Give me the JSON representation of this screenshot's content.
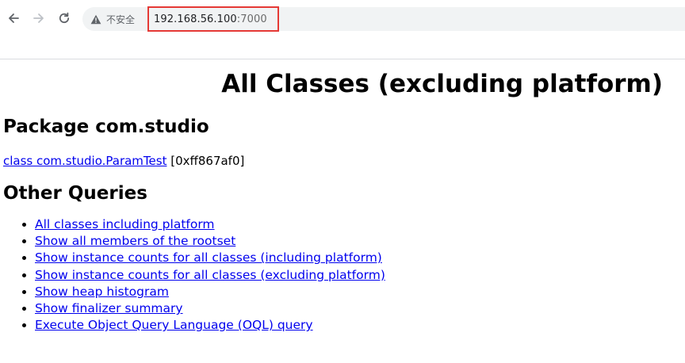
{
  "browser": {
    "security_label": "不安全",
    "url_host": "192.168.56.100",
    "url_port": ":7000",
    "icons": {
      "back": "arrow-left-icon",
      "forward": "arrow-right-icon",
      "reload": "reload-icon",
      "security": "warning-triangle-icon"
    }
  },
  "page": {
    "title": "All Classes (excluding platform)",
    "package_heading": "Package com.studio",
    "class_link": "class com.studio.ParamTest",
    "class_address": "[0xff867af0]",
    "other_heading": "Other Queries",
    "queries": [
      "All classes including platform",
      "Show all members of the rootset",
      "Show instance counts for all classes (including platform)",
      "Show instance counts for all classes (excluding platform)",
      "Show heap histogram",
      "Show finalizer summary",
      "Execute Object Query Language (OQL) query"
    ]
  },
  "colors": {
    "link": "#0000ee",
    "url_highlight_border": "#e53935",
    "omnibox_bg": "#f1f3f4"
  }
}
